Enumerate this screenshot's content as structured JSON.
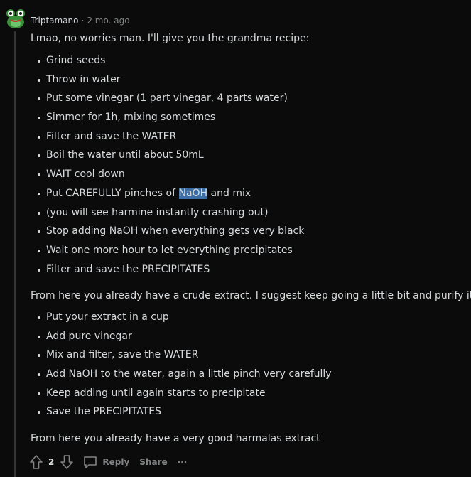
{
  "comment": {
    "author": "Triptamano",
    "separator": "·",
    "time": "2 mo. ago",
    "intro": "Lmao, no worries man. I'll give you the grandma recipe:",
    "steps_part1": [
      "Grind seeds",
      "Throw in water",
      "Put some vinegar (1 part vinegar, 4 parts water)",
      "Simmer for 1h, mixing sometimes",
      "Filter and save the WATER",
      "Boil the water until about 50mL",
      "WAIT cool down"
    ],
    "step8": {
      "before": "Put CAREFULLY pinches of ",
      "highlight": "NaOH",
      "after": " and mix"
    },
    "steps_part2": [
      "(you will see harmine instantly crashing out)",
      "Stop adding NaOH when everything gets very black",
      "Wait one more hour to let everything precipitates",
      "Filter and save the PRECIPITATES"
    ],
    "mid": "From here you already have a crude extract. I suggest keep going a little bit and purify it:",
    "purify_steps": [
      "Put your extract in a cup",
      "Add pure vinegar",
      "Mix and filter, save the WATER",
      "Add NaOH to the water, again a little pinch very carefully",
      "Keep adding until again starts to precipitate",
      "Save the PRECIPITATES"
    ],
    "outro": "From here you already have a very good harmalas extract",
    "votes": "2",
    "reply_label": "Reply",
    "share_label": "Share",
    "more_label": "···"
  },
  "icons": {
    "avatar": "frog-avatar-icon",
    "upvote": "arrow-up-icon",
    "downvote": "arrow-down-icon",
    "reply": "speech-bubble-icon",
    "more": "ellipsis-icon"
  },
  "colors": {
    "background": "#0b0b0b",
    "text": "#d7dadc",
    "muted": "#818384",
    "selection": "#3b6ea5",
    "thread_line": "#343536"
  }
}
